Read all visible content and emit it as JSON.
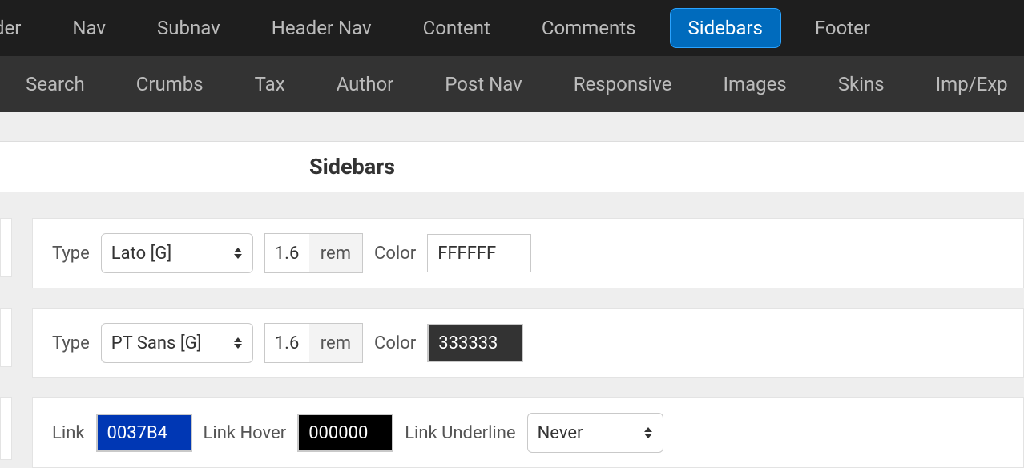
{
  "tabs_primary": [
    {
      "label": "der",
      "active": false
    },
    {
      "label": "Nav",
      "active": false
    },
    {
      "label": "Subnav",
      "active": false
    },
    {
      "label": "Header Nav",
      "active": false
    },
    {
      "label": "Content",
      "active": false
    },
    {
      "label": "Comments",
      "active": false
    },
    {
      "label": "Sidebars",
      "active": true
    },
    {
      "label": "Footer",
      "active": false
    }
  ],
  "tabs_secondary": [
    {
      "label": "Search"
    },
    {
      "label": "Crumbs"
    },
    {
      "label": "Tax"
    },
    {
      "label": "Author"
    },
    {
      "label": "Post Nav"
    },
    {
      "label": "Responsive"
    },
    {
      "label": "Images"
    },
    {
      "label": "Skins"
    },
    {
      "label": "Imp/Exp"
    }
  ],
  "section_title": "Sidebars",
  "row1": {
    "type_label": "Type",
    "font": "Lato [G]",
    "size": "1.6",
    "unit": "rem",
    "color_label": "Color",
    "color_value": "FFFFFF"
  },
  "row2": {
    "type_label": "Type",
    "font": "PT Sans [G]",
    "size": "1.6",
    "unit": "rem",
    "color_label": "Color",
    "color_value": "333333"
  },
  "row3": {
    "link_label": "Link",
    "link_color": "0037B4",
    "link_hover_label": "Link Hover",
    "link_hover_color": "000000",
    "link_underline_label": "Link Underline",
    "link_underline_value": "Never"
  }
}
